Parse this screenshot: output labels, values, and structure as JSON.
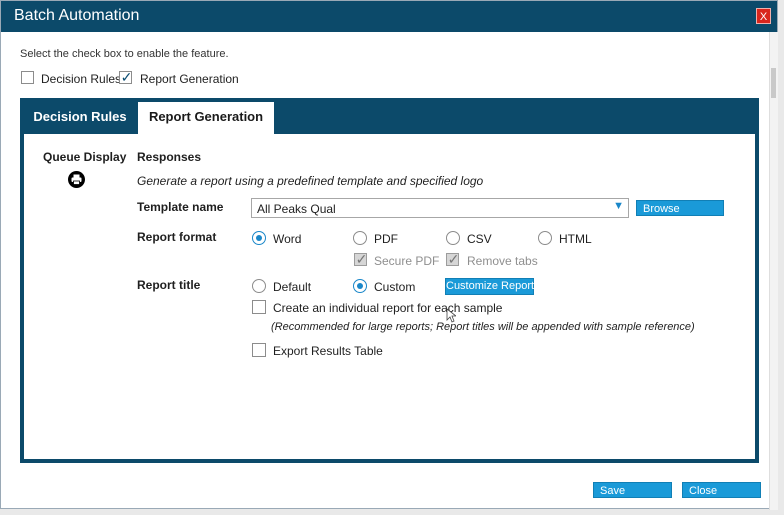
{
  "window": {
    "title": "Batch Automation",
    "close_label": "X"
  },
  "instructions": "Select the check box to enable the feature.",
  "features": [
    {
      "label": "Decision Rules",
      "checked": false
    },
    {
      "label": "Report Generation",
      "checked": true
    }
  ],
  "tabs": [
    {
      "label": "Decision Rules",
      "active": false
    },
    {
      "label": "Report Generation",
      "active": true
    }
  ],
  "left": {
    "queue_display_label": "Queue Display",
    "icon": "printer-icon"
  },
  "responses": {
    "heading": "Responses",
    "description": "Generate a report using a predefined template and specified logo",
    "template": {
      "label": "Template name",
      "value": "All Peaks Qual",
      "browse_label": "Browse"
    },
    "report_format": {
      "label": "Report format",
      "options": [
        {
          "label": "Word",
          "selected": true
        },
        {
          "label": "PDF",
          "selected": false
        },
        {
          "label": "CSV",
          "selected": false
        },
        {
          "label": "HTML",
          "selected": false
        }
      ],
      "secure_pdf": {
        "label": "Secure PDF",
        "checked": true,
        "disabled": true
      },
      "remove_tabs": {
        "label": "Remove tabs",
        "checked": true,
        "disabled": true
      }
    },
    "report_title": {
      "label": "Report title",
      "options": [
        {
          "label": "Default",
          "selected": false
        },
        {
          "label": "Custom",
          "selected": true
        }
      ],
      "customize_label": "Customize Report",
      "individual_report": {
        "label": "Create an individual report for each sample",
        "checked": false
      },
      "note": "(Recommended for large reports; Report titles will be appended with sample reference)",
      "export_results": {
        "label": "Export Results Table",
        "checked": false
      }
    }
  },
  "footer": {
    "save_label": "Save",
    "close_label": "Close"
  },
  "colors": {
    "header": "#0c4a6a",
    "accent": "#1a9ad8",
    "close": "#d9261c"
  }
}
